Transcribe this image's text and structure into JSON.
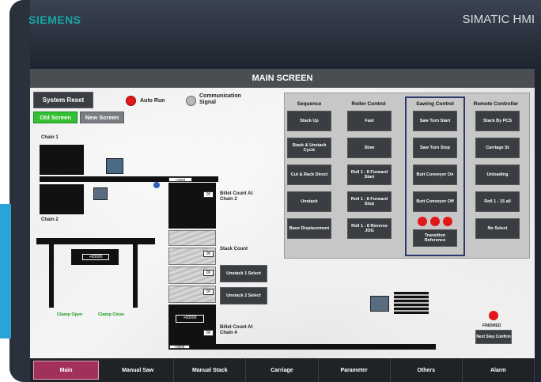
{
  "header": {
    "brand": "SIEMENS",
    "product": "SIMATIC HMI"
  },
  "screen": {
    "title": "MAIN SCREEN",
    "system_reset": "System Reset",
    "old_screen": "Old Screen",
    "new_screen": "New Screen",
    "auto_run": "Auto Run",
    "comm_signal": "Communication Signal",
    "chain1": "Chain 1",
    "chain2": "Chain 2",
    "billet_count_c2": "Billet Count At Chain 2",
    "stack_count": "Stack Count",
    "billet_count_c4": "Billet Count At Chain 4",
    "clamp_open": "Clamp Open",
    "clamp_close": "Clamp Close",
    "counter_top": "+0000",
    "counter_crane": "+00000",
    "counter_bottom": "+0000",
    "counter_stack": "+00000",
    "small_counter": "00",
    "unstack1": "Unstack 1 Select",
    "unstack2": "Unstack 2 Select",
    "finished": "FINISHED",
    "next_step": "Next Step Confirm"
  },
  "panel": {
    "columns": [
      "Sequence",
      "Roller Control",
      "Sawing Control",
      "Remote Controller"
    ],
    "sequence": [
      "Stack Up",
      "Stack & Unstack Cycle",
      "Cut & Rack Direct",
      "Unstack",
      "Base Displacement"
    ],
    "roller": [
      "Fast",
      "Slow",
      "Roll 1 - 8 Forward Start",
      "Roll 1 - 8 Forward Stop",
      "Roll 1 - 8 Reverse JOG"
    ],
    "sawing": [
      "Saw Turn Start",
      "Saw Turn Stop",
      "Butt Conveyor On",
      "Butt Conveyor Off"
    ],
    "transition": "Transition Reference",
    "remote": [
      "Stack By PCS",
      "Carriage St",
      "Unloading",
      "Roll 1 - 15 all",
      "No Select"
    ]
  },
  "nav": [
    "Main",
    "Manual Saw",
    "Manual Stack",
    "Carriage",
    "Parameter",
    "Others",
    "Alarm"
  ],
  "colors": {
    "accent": "#a2305c",
    "green": "#33c033",
    "red": "#e01818",
    "brand": "#18a7a5"
  }
}
